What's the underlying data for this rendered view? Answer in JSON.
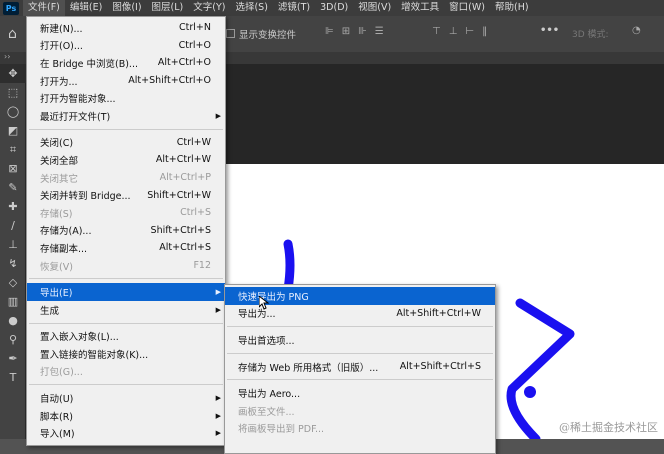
{
  "menubar": {
    "items": [
      "文件(F)",
      "编辑(E)",
      "图像(I)",
      "图层(L)",
      "文字(Y)",
      "选择(S)",
      "滤镜(T)",
      "3D(D)",
      "视图(V)",
      "增效工具",
      "窗口(W)",
      "帮助(H)"
    ]
  },
  "options": {
    "show_transform": "显示变换控件",
    "mode_3d": "3D 模式:"
  },
  "file_menu": [
    {
      "label": "新建(N)...",
      "shortcut": "Ctrl+N"
    },
    {
      "label": "打开(O)...",
      "shortcut": "Ctrl+O"
    },
    {
      "label": "在 Bridge 中浏览(B)...",
      "shortcut": "Alt+Ctrl+O"
    },
    {
      "label": "打开为...",
      "shortcut": "Alt+Shift+Ctrl+O"
    },
    {
      "label": "打开为智能对象..."
    },
    {
      "label": "最近打开文件(T)"
    },
    {
      "label": "关闭(C)",
      "shortcut": "Ctrl+W"
    },
    {
      "label": "关闭全部",
      "shortcut": "Alt+Ctrl+W"
    },
    {
      "label": "关闭其它",
      "shortcut": "Alt+Ctrl+P"
    },
    {
      "label": "关闭并转到 Bridge...",
      "shortcut": "Shift+Ctrl+W"
    },
    {
      "label": "存储(S)",
      "shortcut": "Ctrl+S"
    },
    {
      "label": "存储为(A)...",
      "shortcut": "Shift+Ctrl+S"
    },
    {
      "label": "存储副本...",
      "shortcut": "Alt+Ctrl+S"
    },
    {
      "label": "恢复(V)",
      "shortcut": "F12"
    },
    {
      "label": "导出(E)"
    },
    {
      "label": "生成"
    },
    {
      "label": "置入嵌入对象(L)..."
    },
    {
      "label": "置入链接的智能对象(K)..."
    },
    {
      "label": "打包(G)..."
    },
    {
      "label": "自动(U)"
    },
    {
      "label": "脚本(R)"
    },
    {
      "label": "导入(M)"
    }
  ],
  "export_submenu": [
    {
      "label": "快速导出为 PNG"
    },
    {
      "label": "导出为...",
      "shortcut": "Alt+Shift+Ctrl+W"
    },
    {
      "label": "导出首选项..."
    },
    {
      "label": "存储为 Web 所用格式（旧版）...",
      "shortcut": "Alt+Shift+Ctrl+S"
    },
    {
      "label": "导出为 Aero..."
    },
    {
      "label": "画板至文件..."
    },
    {
      "label": "将画板导出到 PDF..."
    }
  ],
  "watermark": "@稀土掘金技术社区",
  "colors": {
    "highlight": "#0a64d0",
    "stroke": "#1a10f0"
  }
}
